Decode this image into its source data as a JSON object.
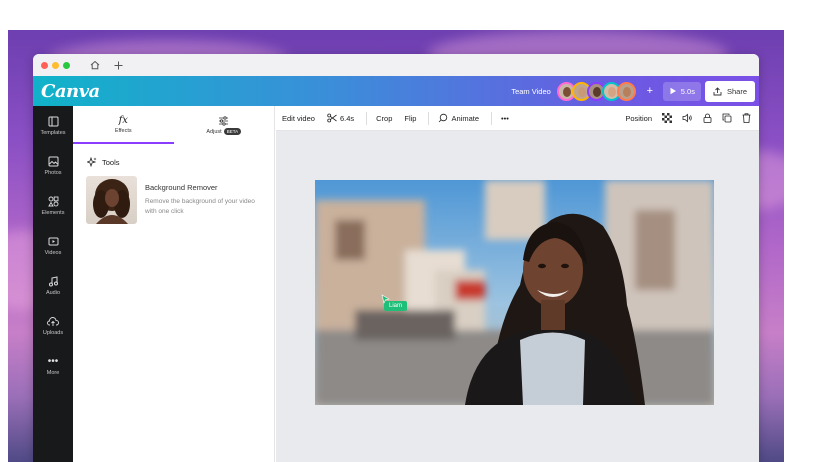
{
  "browser": {
    "nav_icons": [
      "home-icon",
      "plus-icon"
    ]
  },
  "topbar": {
    "logo": "Canva",
    "team_label": "Team Video",
    "add_label": "+",
    "play_label": "5.0s",
    "share_label": "Share",
    "avatar_colors": [
      "#7a4f36",
      "#c89a78",
      "#5a3a2a",
      "#d6a483",
      "#b77f5c"
    ],
    "avatar_rings": [
      "#ff6ad5",
      "#ffb400",
      "#8b3dff",
      "#00c4cc",
      "#ff7b4d"
    ]
  },
  "sidebar": {
    "items": [
      {
        "label": "Templates",
        "icon": "templates-icon"
      },
      {
        "label": "Photos",
        "icon": "photos-icon"
      },
      {
        "label": "Elements",
        "icon": "elements-icon"
      },
      {
        "label": "Videos",
        "icon": "videos-icon"
      },
      {
        "label": "Audio",
        "icon": "audio-icon"
      },
      {
        "label": "Uploads",
        "icon": "uploads-icon"
      },
      {
        "label": "More",
        "icon": "more-icon"
      }
    ]
  },
  "panel": {
    "tabs": [
      {
        "label": "Effects",
        "icon_text": "fx"
      },
      {
        "label": "Adjust",
        "badge": "BETA"
      }
    ],
    "tools_heading": "Tools",
    "tool": {
      "title": "Background Remover",
      "description": "Remove the background of your video with one click"
    }
  },
  "toolbar": {
    "edit_video": "Edit video",
    "duration": "6.4s",
    "crop": "Crop",
    "flip": "Flip",
    "animate": "Animate",
    "more": "•••",
    "position": "Position"
  },
  "canvas": {
    "collaborator_tag": "Liam"
  },
  "colors": {
    "accent": "#8b3dff",
    "sidebar_bg": "#18191b",
    "collab_green": "#1fbf7a"
  }
}
